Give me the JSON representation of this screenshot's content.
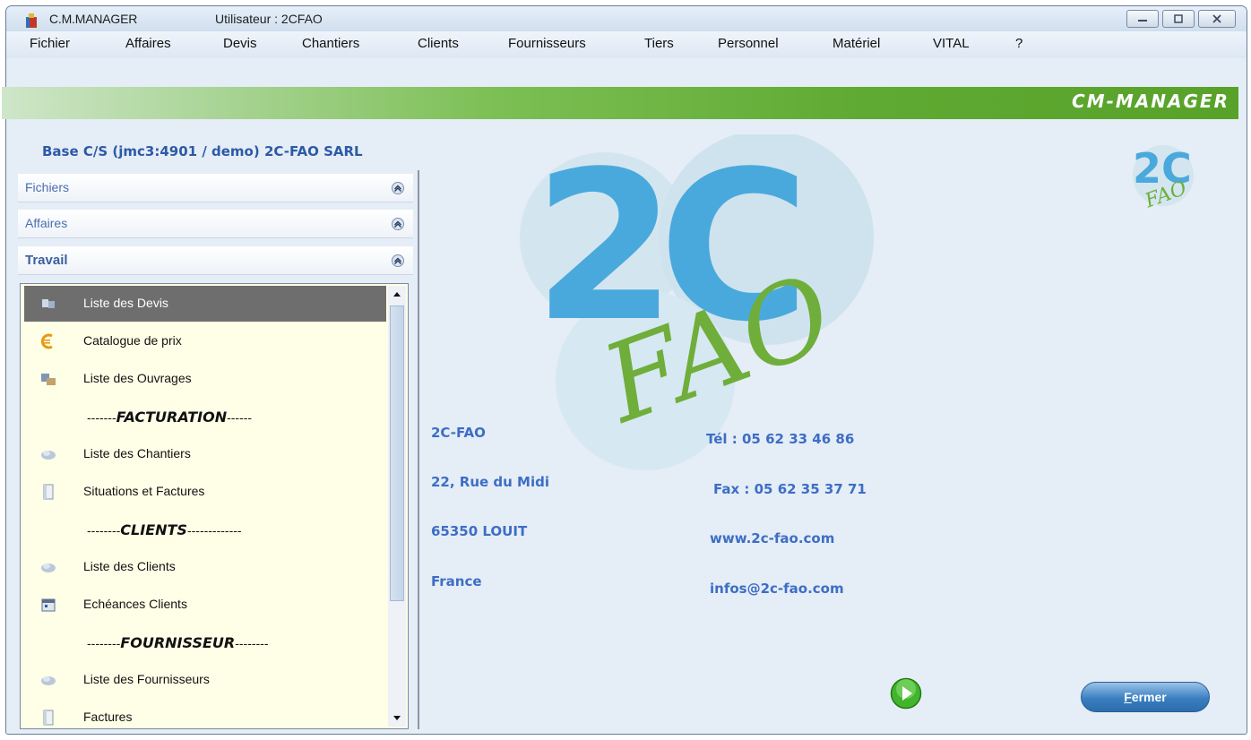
{
  "window": {
    "app_title": "C.M.MANAGER",
    "user": "Utilisateur : 2CFAO",
    "controls": [
      "minimize-icon",
      "maximize-icon",
      "close-icon"
    ]
  },
  "menubar": {
    "items": [
      "Fichier",
      "Affaires",
      "Devis",
      "Chantiers",
      "Clients",
      "Fournisseurs",
      "Tiers",
      "Personnel",
      "Matériel",
      "VITAL",
      "?"
    ]
  },
  "banner": {
    "text": "CM-MANAGER"
  },
  "base_label": "Base C/S (jmc3:4901 / demo)  2C-FAO SARL",
  "sections": [
    {
      "label": "Fichiers"
    },
    {
      "label": "Affaires"
    },
    {
      "label": "Travail"
    }
  ],
  "list": {
    "items": [
      {
        "label": "Liste des Devis",
        "icon": "quotes-list-icon",
        "selected": true
      },
      {
        "label": "Catalogue de prix",
        "icon": "euro-icon"
      },
      {
        "label": "Liste des Ouvrages",
        "icon": "works-icon"
      },
      {
        "sep_prefix": "-------",
        "sep_bold": "FACTURATION",
        "sep_suffix": "------"
      },
      {
        "label": "Liste des Chantiers",
        "icon": "sites-icon"
      },
      {
        "label": "Situations et Factures",
        "icon": "invoice-icon"
      },
      {
        "sep_prefix": "--------",
        "sep_bold": "CLIENTS",
        "sep_suffix": "-------------"
      },
      {
        "label": "Liste des Clients",
        "icon": "clients-icon"
      },
      {
        "label": "Echéances Clients",
        "icon": "calendar-icon"
      },
      {
        "sep_prefix": "--------",
        "sep_bold": "FOURNISSEUR",
        "sep_suffix": "--------"
      },
      {
        "label": "Liste des Fournisseurs",
        "icon": "suppliers-icon"
      },
      {
        "label": "Factures",
        "icon": "invoice-icon"
      }
    ]
  },
  "company": {
    "name": "2C-FAO",
    "street": "22, Rue du Midi",
    "city": "65350 LOUIT",
    "country": "France",
    "phone": "Tél : 05 62 33 46 86",
    "fax": "Fax : 05 62 35 37 71",
    "web": "www.2c-fao.com",
    "email": "infos@2c-fao.com"
  },
  "logo": {
    "top": "2C",
    "bottom": "FAO",
    "blue": "#4aa9dc",
    "green": "#6fae3a",
    "circle": "#cfe3ee"
  },
  "buttons": {
    "close_first": "F",
    "close_rest": "ermer"
  },
  "colors": {
    "banner_green": "#5faa32",
    "link_blue": "#3d6ec5",
    "selected_row": "#6e6e6e",
    "list_bg": "#ffffe8"
  }
}
